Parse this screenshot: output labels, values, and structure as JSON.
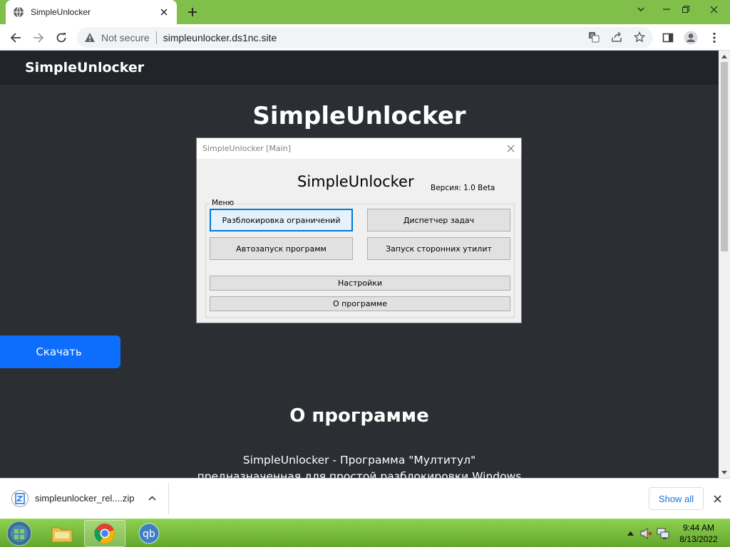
{
  "browser": {
    "tab_title": "SimpleUnlocker",
    "not_secure": "Not secure",
    "url": "simpleunlocker.ds1nc.site"
  },
  "site": {
    "brand": "SimpleUnlocker",
    "hero_title": "SimpleUnlocker",
    "download_button": "Скачать",
    "about_title": "О программе",
    "about_text": "SimpleUnlocker - Программа \"Мултитул\" предназначенная для простой разблокировки Windows от вирусов"
  },
  "dialog": {
    "title": "SimpleUnlocker [Main]",
    "app_name": "SimpleUnlocker",
    "version": "Версия: 1.0 Beta",
    "group_label": "Меню",
    "buttons": {
      "unlock": "Разблокировка ограничений",
      "task_manager": "Диспетчер задач",
      "autorun": "Автозапуск программ",
      "third_party": "Запуск сторонних утилит",
      "settings": "Настройки",
      "about": "О программе"
    }
  },
  "downloads": {
    "filename": "simpleunlocker_rel....zip",
    "show_all": "Show all"
  },
  "taskbar": {
    "time": "9:44 AM",
    "date": "8/13/2022"
  },
  "colors": {
    "page_bg": "#2b2f33",
    "navbar_bg": "#212529",
    "primary": "#0d6efd",
    "taskbar_green": "#7fbf4a"
  }
}
